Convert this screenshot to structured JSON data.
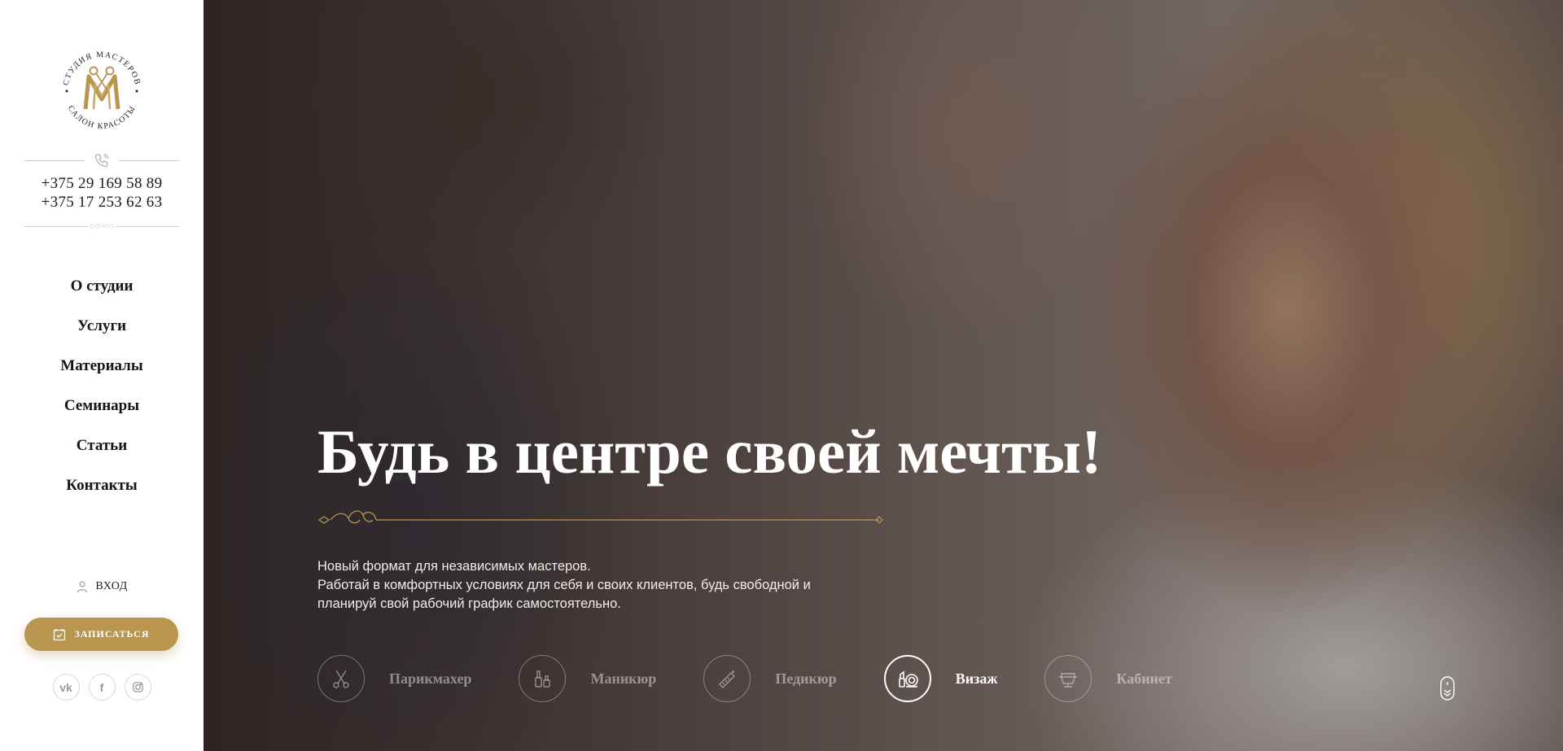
{
  "logo": {
    "top_text": "СТУДИЯ МАСТЕРОВ",
    "bottom_text": "САЛОН КРАСОТЫ",
    "monogram": "M"
  },
  "contacts": {
    "phones": [
      "+375 29 169 58 89",
      "+375 17 253 62 63"
    ]
  },
  "nav": {
    "items": [
      {
        "label": "О студии"
      },
      {
        "label": "Услуги"
      },
      {
        "label": "Материалы"
      },
      {
        "label": "Семинары"
      },
      {
        "label": "Статьи"
      },
      {
        "label": "Контакты"
      }
    ]
  },
  "account": {
    "login_label": "ВХОД",
    "signup_label": "ЗАПИСАТЬСЯ"
  },
  "socials": [
    "vk-icon",
    "facebook-icon",
    "instagram-icon"
  ],
  "hero": {
    "headline": "Будь в центре своей мечты!",
    "subtext": [
      "Новый формат для независимых мастеров.",
      "Работай в комфортных условиях для себя и своих клиентов, будь свободной и",
      "планируй свой рабочий график самостоятельно."
    ],
    "services": [
      {
        "label": "Парикмахер",
        "icon": "scissors-icon",
        "active": false
      },
      {
        "label": "Маникюр",
        "icon": "nail-polish-icon",
        "active": false
      },
      {
        "label": "Педикюр",
        "icon": "nail-file-icon",
        "active": false
      },
      {
        "label": "Визаж",
        "icon": "makeup-icon",
        "active": true
      },
      {
        "label": "Кабинет",
        "icon": "salon-chair-icon",
        "active": false
      }
    ]
  },
  "colors": {
    "accent": "#b8964f",
    "text_dark": "#151515"
  }
}
